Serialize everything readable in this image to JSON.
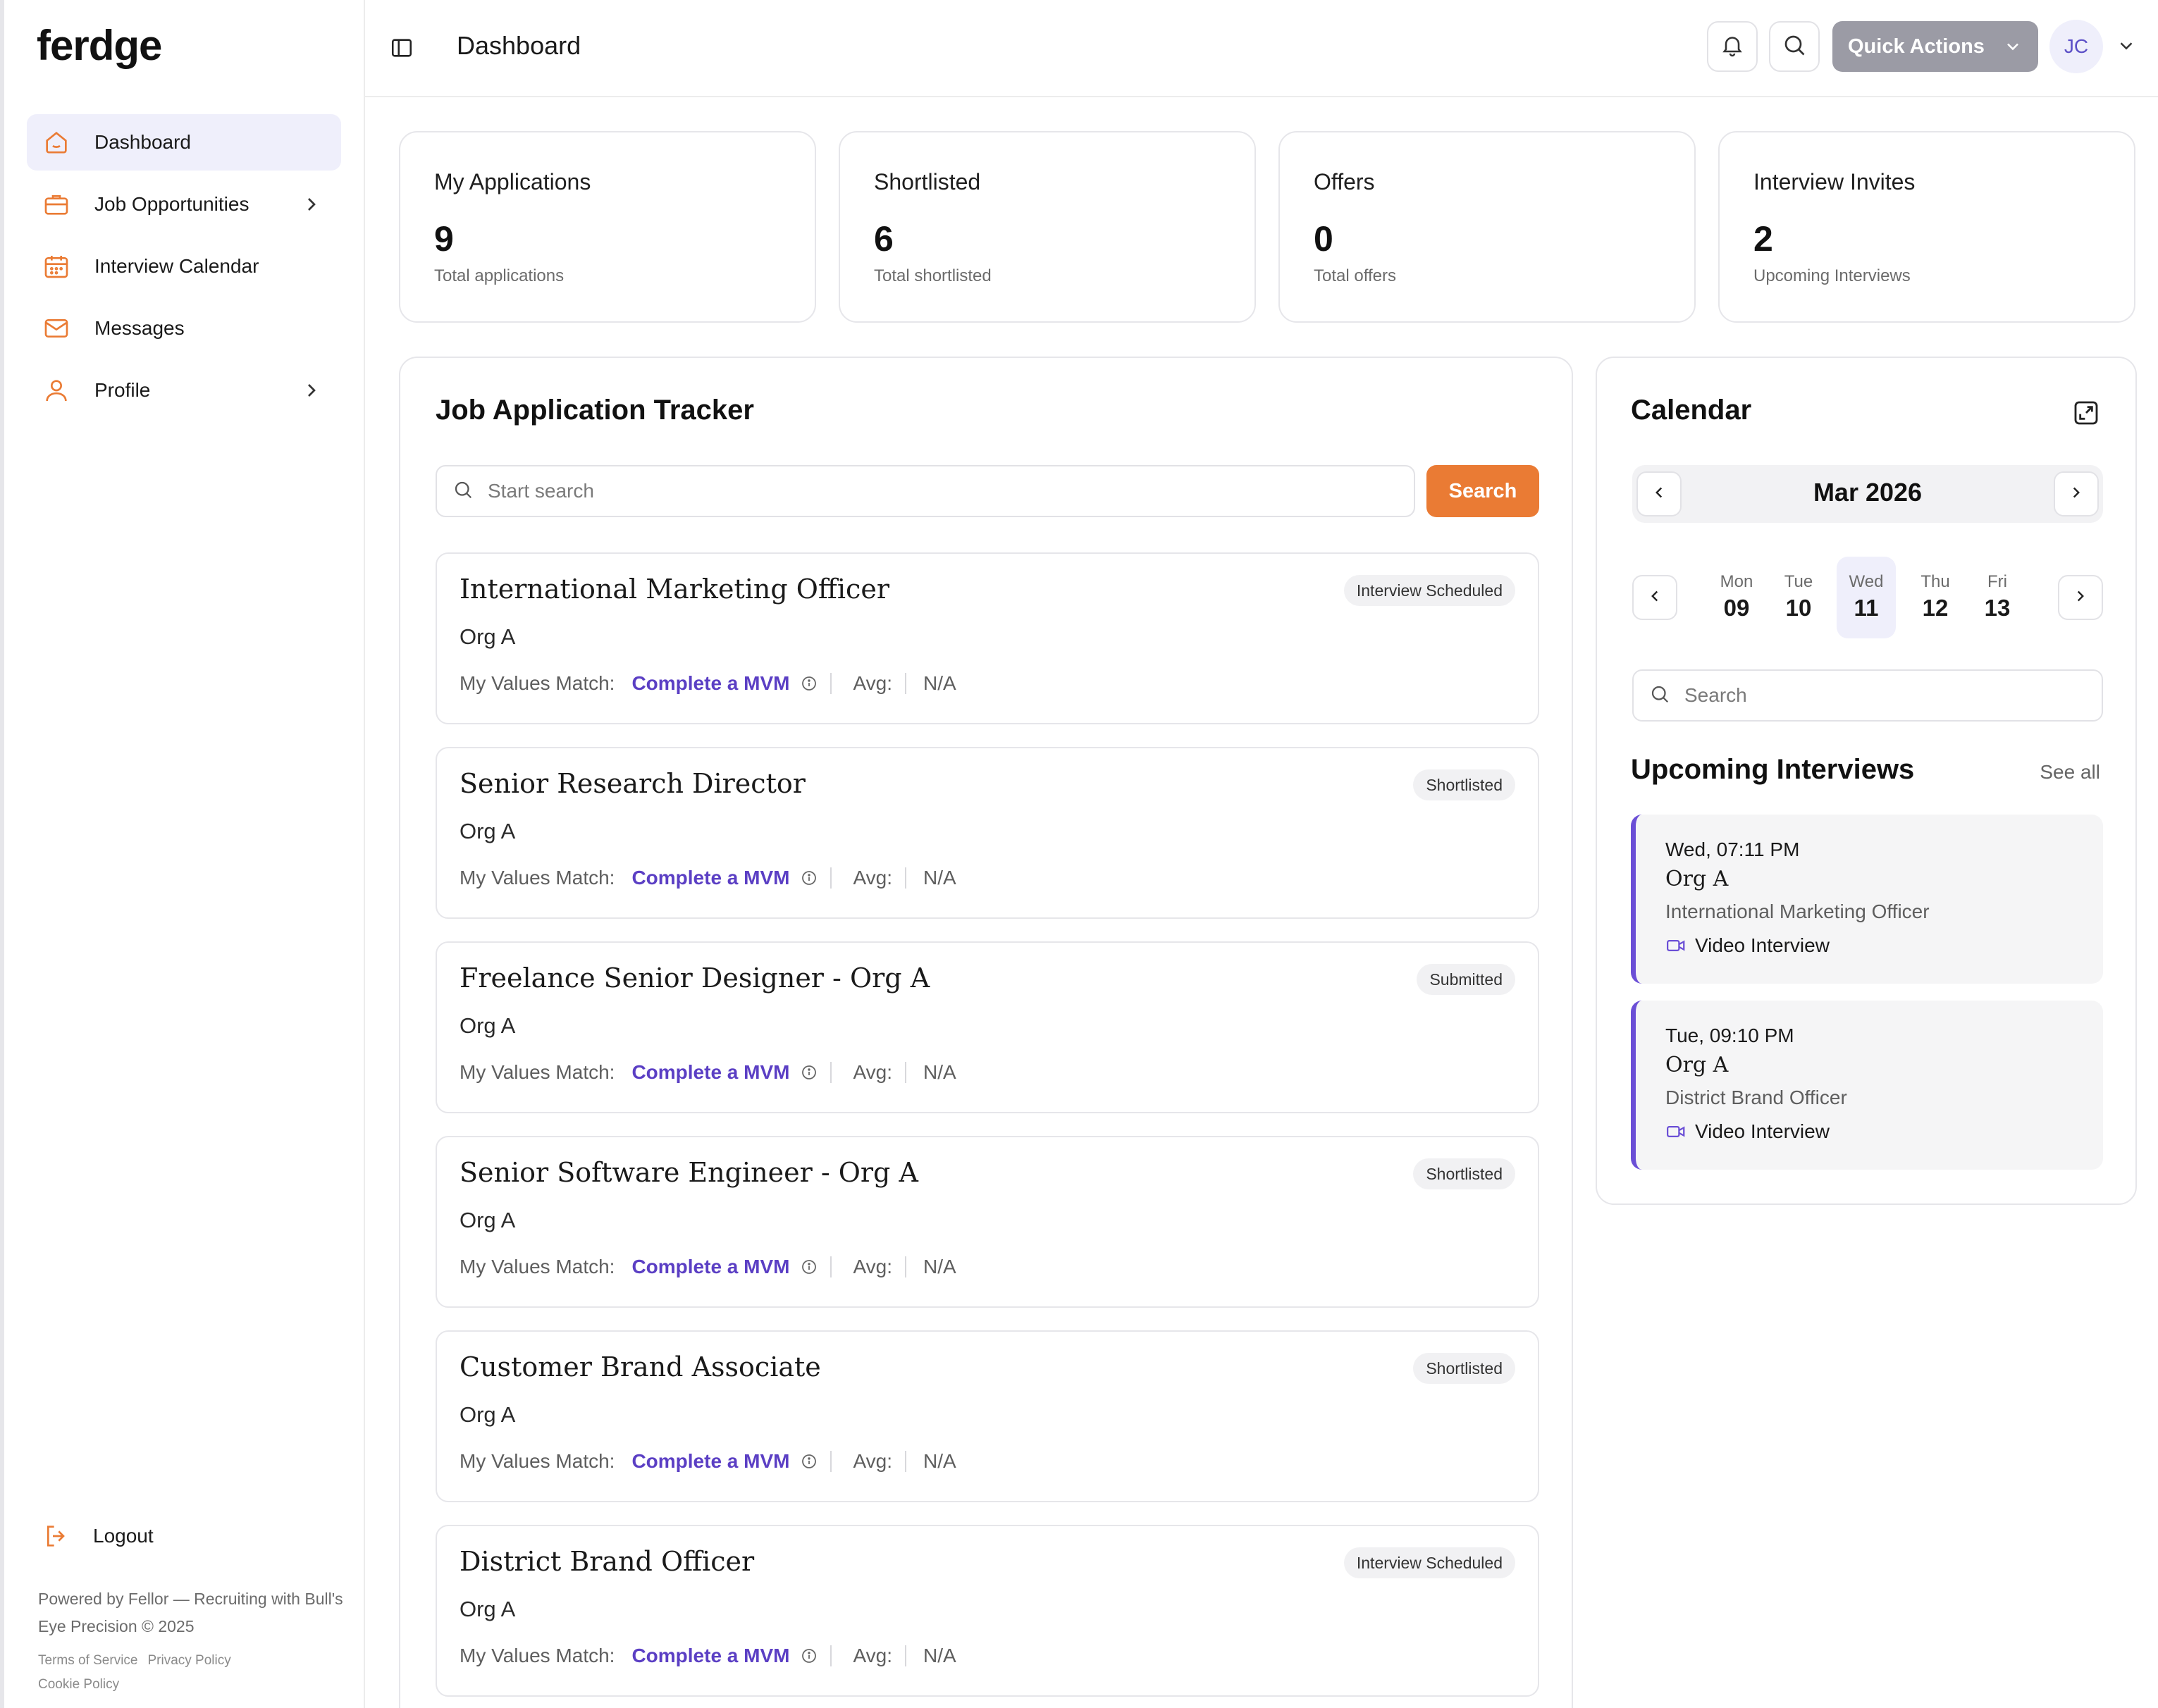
{
  "sidebar": {
    "logo": "ferdge",
    "items": [
      {
        "label": "Dashboard"
      },
      {
        "label": "Job Opportunities"
      },
      {
        "label": "Interview Calendar"
      },
      {
        "label": "Messages"
      },
      {
        "label": "Profile"
      }
    ],
    "logout": "Logout",
    "footer": "Powered by Fellor — Recruiting with Bull's Eye Precision © 2025",
    "links": [
      "Terms of Service",
      "Privacy Policy",
      "Cookie Policy"
    ]
  },
  "header": {
    "title": "Dashboard",
    "quick_actions": "Quick Actions",
    "avatar": "JC"
  },
  "stats": [
    {
      "label": "My Applications",
      "value": "9",
      "sub": "Total applications"
    },
    {
      "label": "Shortlisted",
      "value": "6",
      "sub": "Total shortlisted"
    },
    {
      "label": "Offers",
      "value": "0",
      "sub": "Total offers"
    },
    {
      "label": "Interview Invites",
      "value": "2",
      "sub": "Upcoming Interviews"
    }
  ],
  "tracker": {
    "title": "Job Application Tracker",
    "search_placeholder": "Start search",
    "search_button": "Search",
    "meta_label": "My Values Match:",
    "mvm_link": "Complete a MVM",
    "avg_label": "Avg:",
    "avg_value": "N/A",
    "jobs": [
      {
        "title": "International Marketing Officer",
        "org": "Org A",
        "status": "Interview Scheduled"
      },
      {
        "title": "Senior Research Director",
        "org": "Org A",
        "status": "Shortlisted"
      },
      {
        "title": "Freelance Senior Designer - Org A",
        "org": "Org A",
        "status": "Submitted"
      },
      {
        "title": "Senior Software Engineer - Org A",
        "org": "Org A",
        "status": "Shortlisted"
      },
      {
        "title": "Customer Brand Associate",
        "org": "Org A",
        "status": "Shortlisted"
      },
      {
        "title": "District Brand Officer",
        "org": "Org A",
        "status": "Interview Scheduled"
      }
    ]
  },
  "calendar": {
    "title": "Calendar",
    "month": "Mar 2026",
    "days": [
      {
        "name": "Mon",
        "num": "09"
      },
      {
        "name": "Tue",
        "num": "10"
      },
      {
        "name": "Wed",
        "num": "11"
      },
      {
        "name": "Thu",
        "num": "12"
      },
      {
        "name": "Fri",
        "num": "13"
      }
    ],
    "selected_day": "Wed",
    "search_placeholder": "Search",
    "upcoming_title": "Upcoming Interviews",
    "see_all": "See all",
    "interviews": [
      {
        "time": "Wed, 07:11 PM",
        "org": "Org A",
        "role": "International Marketing Officer",
        "type": "Video Interview"
      },
      {
        "time": "Tue, 09:10 PM",
        "org": "Org A",
        "role": "District Brand Officer",
        "type": "Video Interview"
      }
    ]
  },
  "colors": {
    "accent_orange": "#ea7b34",
    "accent_purple": "#5b3fc4",
    "active_bg": "#efeffb"
  }
}
